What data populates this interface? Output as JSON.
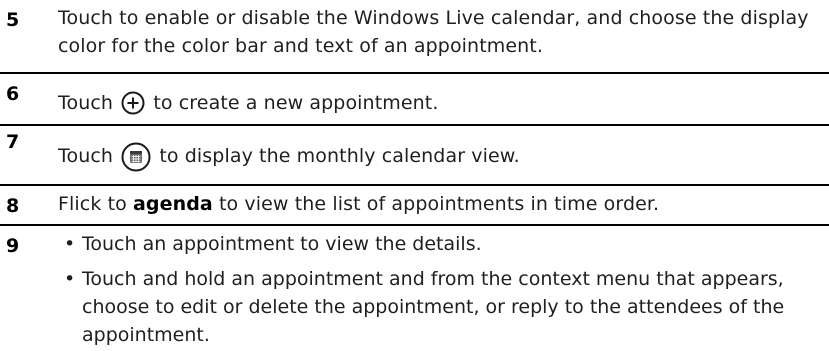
{
  "steps": [
    {
      "number": "5",
      "text": "Touch to enable or disable the Windows Live calendar, and choose the display color for the color bar and text of an appointment."
    },
    {
      "number": "6",
      "text_before": "Touch",
      "icon": "plus-circle-icon",
      "text_after": "to create a new appointment."
    },
    {
      "number": "7",
      "text_before": "Touch",
      "icon": "calendar-button-icon",
      "text_after": "to display the monthly calendar view."
    },
    {
      "number": "8",
      "text_before": "Flick to",
      "keyword": "agenda",
      "text_after": "to view the list of appointments in time order."
    },
    {
      "number": "9",
      "bullets": [
        "Touch an appointment to view the details.",
        "Touch and hold an appointment and from the context menu that appears, choose to edit or delete the appointment, or reply to the attendees of the appointment."
      ]
    }
  ],
  "bullet_char": "•"
}
